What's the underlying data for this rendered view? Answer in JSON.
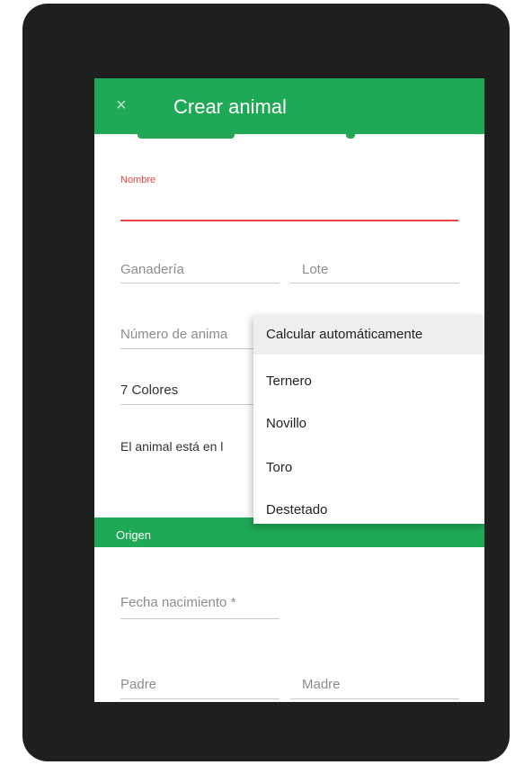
{
  "app_bar": {
    "close_icon": "×",
    "title": "Crear animal"
  },
  "form": {
    "nombre_label": "Nombre",
    "ganaderia_placeholder": "Ganadería",
    "lote_placeholder": "Lote",
    "numero_placeholder": "Número de anima",
    "colores_value": "7 Colores",
    "animal_esta_text": "El animal está en l",
    "origen_section": "Origen",
    "fecha_placeholder": "Fecha nacimiento *",
    "padre_placeholder": "Padre",
    "madre_placeholder": "Madre"
  },
  "dropdown_menu": {
    "items": [
      "Calcular automáticamente",
      "Ternero",
      "Novillo",
      "Toro",
      "Destetado"
    ]
  },
  "colors": {
    "primary_green": "#1fa855",
    "error_red": "#e8453c"
  }
}
